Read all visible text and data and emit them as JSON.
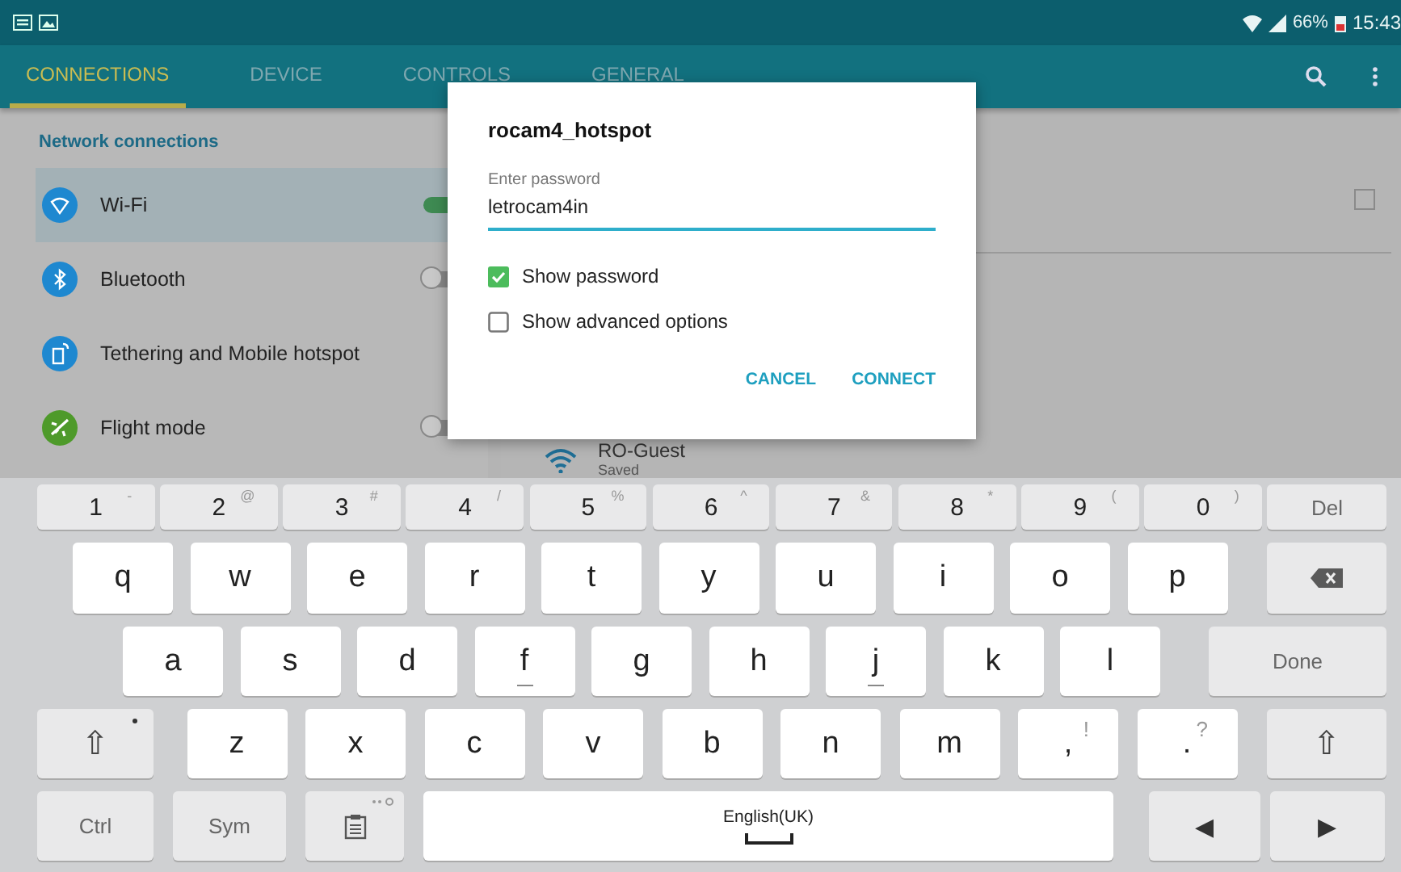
{
  "status_bar": {
    "battery": "66%",
    "time": "15:43"
  },
  "tabs": [
    {
      "label": "CONNECTIONS",
      "selected": true
    },
    {
      "label": "DEVICE",
      "selected": false
    },
    {
      "label": "CONTROLS",
      "selected": false
    },
    {
      "label": "GENERAL",
      "selected": false
    }
  ],
  "left_panel": {
    "header": "Network connections",
    "items": [
      {
        "label": "Wi-Fi",
        "kind": "wifi",
        "selected": true,
        "on": true,
        "color": "#1e88d0"
      },
      {
        "label": "Bluetooth",
        "kind": "bluetooth",
        "selected": false,
        "on": false,
        "color": "#1e88d0"
      },
      {
        "label": "Tethering and Mobile hotspot",
        "kind": "hotspot",
        "selected": false,
        "color": "#1e88d0"
      },
      {
        "label": "Flight mode",
        "kind": "plane",
        "selected": false,
        "on": false,
        "color": "#4e9a2a"
      }
    ]
  },
  "right_panel": {
    "checkbox_checked": false,
    "networks": [
      {
        "name": "RO-Guest",
        "status": "Saved"
      }
    ]
  },
  "dialog": {
    "title": "rocam4_hotspot",
    "field_label": "Enter password",
    "field_value": "letrocam4in",
    "options": [
      {
        "label": "Show password",
        "checked": true
      },
      {
        "label": "Show advanced options",
        "checked": false
      }
    ],
    "buttons": [
      "CANCEL",
      "CONNECT"
    ]
  },
  "keyboard": {
    "language": "English(UK)",
    "rows": [
      {
        "keys": [
          {
            "kind": "num",
            "label": "1",
            "sub": "-"
          },
          {
            "kind": "num",
            "label": "2",
            "sub": "@"
          },
          {
            "kind": "num",
            "label": "3",
            "sub": "#"
          },
          {
            "kind": "num",
            "label": "4",
            "sub": "/"
          },
          {
            "kind": "num",
            "label": "5",
            "sub": "%"
          },
          {
            "kind": "num",
            "label": "6",
            "sub": "^"
          },
          {
            "kind": "num",
            "label": "7",
            "sub": "&"
          },
          {
            "kind": "num",
            "label": "8",
            "sub": "*"
          },
          {
            "kind": "num",
            "label": "9",
            "sub": "("
          },
          {
            "kind": "num",
            "label": "0",
            "sub": ")"
          },
          {
            "kind": "del",
            "label": "Del"
          }
        ]
      },
      {
        "keys": [
          {
            "kind": "letter",
            "label": "q"
          },
          {
            "kind": "letter",
            "label": "w"
          },
          {
            "kind": "letter",
            "label": "e"
          },
          {
            "kind": "letter",
            "label": "r"
          },
          {
            "kind": "letter",
            "label": "t"
          },
          {
            "kind": "letter",
            "label": "y"
          },
          {
            "kind": "letter",
            "label": "u"
          },
          {
            "kind": "letter",
            "label": "i"
          },
          {
            "kind": "letter",
            "label": "o"
          },
          {
            "kind": "letter",
            "label": "p"
          },
          {
            "kind": "backspace"
          }
        ]
      },
      {
        "keys": [
          {
            "kind": "letter",
            "label": "a"
          },
          {
            "kind": "letter",
            "label": "s"
          },
          {
            "kind": "letter",
            "label": "d"
          },
          {
            "kind": "letter",
            "label": "f",
            "home": true
          },
          {
            "kind": "letter",
            "label": "g"
          },
          {
            "kind": "letter",
            "label": "h"
          },
          {
            "kind": "letter",
            "label": "j",
            "home": true
          },
          {
            "kind": "letter",
            "label": "k"
          },
          {
            "kind": "letter",
            "label": "l"
          },
          {
            "kind": "done",
            "label": "Done"
          }
        ]
      },
      {
        "keys": [
          {
            "kind": "shift",
            "label": "⇧",
            "dot": true
          },
          {
            "kind": "letter",
            "label": "z"
          },
          {
            "kind": "letter",
            "label": "x"
          },
          {
            "kind": "letter",
            "label": "c"
          },
          {
            "kind": "letter",
            "label": "v"
          },
          {
            "kind": "letter",
            "label": "b"
          },
          {
            "kind": "letter",
            "label": "n"
          },
          {
            "kind": "letter",
            "label": "m"
          },
          {
            "kind": "letter",
            "label": ",",
            "sub": "!"
          },
          {
            "kind": "letter",
            "label": ".",
            "sub": "?"
          },
          {
            "kind": "shift",
            "label": "⇧",
            "dot": false
          }
        ]
      },
      {
        "keys": [
          {
            "kind": "ctrl",
            "label": "Ctrl"
          },
          {
            "kind": "sym",
            "label": "Sym"
          },
          {
            "kind": "clip"
          },
          {
            "kind": "space"
          },
          {
            "kind": "arrow",
            "label": "◀"
          },
          {
            "kind": "arrow",
            "label": "▶"
          }
        ]
      }
    ]
  }
}
